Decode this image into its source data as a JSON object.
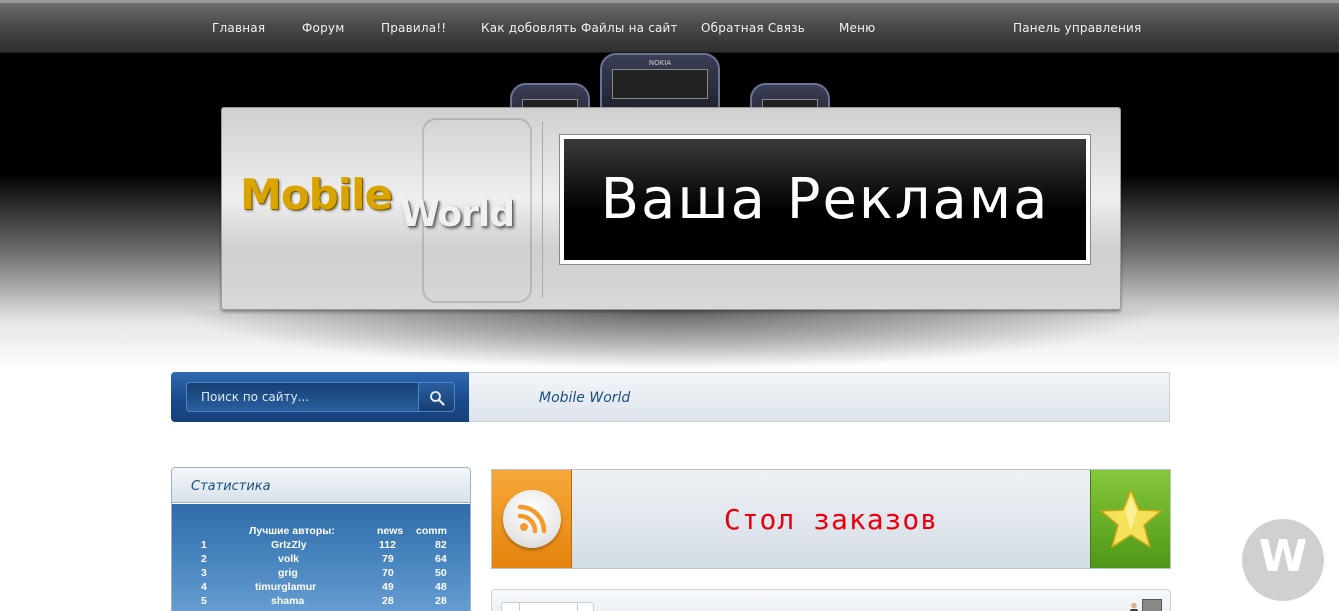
{
  "nav": {
    "items": [
      {
        "label": "Главная"
      },
      {
        "label": "Форум"
      },
      {
        "label": "Правила!!"
      },
      {
        "label": "Как добовлять Файлы на сайт"
      },
      {
        "label": "Обратная Связь"
      },
      {
        "label": "Меню"
      }
    ],
    "control_panel": "Панель управления"
  },
  "header": {
    "logo_part1": "Mobile",
    "logo_part2": "World",
    "ad_text": "Ваша Реклама",
    "phone_brand": "NOKIA"
  },
  "search": {
    "placeholder": "Поиск по сайту..."
  },
  "breadcrumb": "Mobile World",
  "sidebar": {
    "title": "Статистика",
    "stats_header": {
      "label": "Лучшие авторы:",
      "col_news": "news",
      "col_comm": "comm"
    },
    "rows": [
      {
        "rank": "1",
        "name": "GrIzZly",
        "news": "112",
        "comm": "82"
      },
      {
        "rank": "2",
        "name": "volk",
        "news": "79",
        "comm": "64"
      },
      {
        "rank": "3",
        "name": "grig",
        "news": "70",
        "comm": "50"
      },
      {
        "rank": "4",
        "name": "timurglamur",
        "news": "49",
        "comm": "48"
      },
      {
        "rank": "5",
        "name": "shama",
        "news": "28",
        "comm": "28"
      }
    ]
  },
  "orders": {
    "label": "Стол заказов"
  },
  "colors": {
    "accent_blue": "#1a4b8a",
    "orders_red": "#e8000d",
    "rss_orange": "#f39a2a",
    "star_green": "#6ab02a"
  },
  "watermark": "W"
}
